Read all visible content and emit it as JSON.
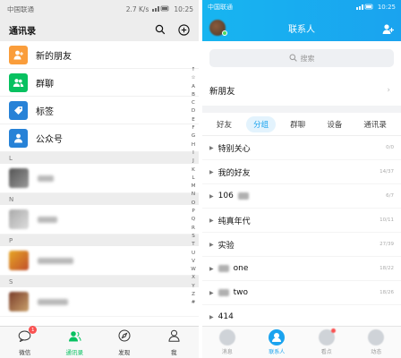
{
  "left": {
    "status": {
      "carrier": "中国联通",
      "speed": "2.7 K/s",
      "time": "10:25"
    },
    "title": "通讯录",
    "fixed_items": [
      {
        "label": "新的朋友",
        "icon": "person-add-icon",
        "color": "#fa9d3b"
      },
      {
        "label": "群聊",
        "icon": "group-icon",
        "color": "#07c160"
      },
      {
        "label": "标签",
        "icon": "tag-icon",
        "color": "#2782d7"
      },
      {
        "label": "公众号",
        "icon": "official-account-icon",
        "color": "#2782d7"
      }
    ],
    "sections": [
      "L",
      "N",
      "P",
      "S"
    ],
    "index": [
      "↑",
      "☆",
      "A",
      "B",
      "C",
      "D",
      "E",
      "F",
      "G",
      "H",
      "I",
      "J",
      "K",
      "L",
      "M",
      "N",
      "O",
      "P",
      "Q",
      "R",
      "S",
      "T",
      "U",
      "V",
      "W",
      "X",
      "Y",
      "Z",
      "#"
    ],
    "tabs": [
      {
        "label": "微信",
        "icon": "chat-icon",
        "badge": "1"
      },
      {
        "label": "通讯录",
        "icon": "contacts-icon",
        "badge": ""
      },
      {
        "label": "发现",
        "icon": "compass-icon",
        "badge": ""
      },
      {
        "label": "我",
        "icon": "me-icon",
        "badge": ""
      }
    ],
    "accent": "#07c160"
  },
  "right": {
    "status": {
      "carrier": "中国联通",
      "time": "10:25"
    },
    "title": "联系人",
    "search_placeholder": "搜索",
    "new_friend": "新朋友",
    "tabs": [
      "好友",
      "分组",
      "群聊",
      "设备",
      "通讯录"
    ],
    "active_tab": "分组",
    "groups": [
      {
        "name": "特别关心",
        "count": "0/0"
      },
      {
        "name": "我的好友",
        "count": "14/37"
      },
      {
        "name": "106",
        "count": "6/7"
      },
      {
        "name": "纯真年代",
        "count": "10/11"
      },
      {
        "name": "实验",
        "count": "27/39"
      },
      {
        "name": "one",
        "count": "18/22"
      },
      {
        "name": "two",
        "count": "18/26"
      },
      {
        "name": "414",
        "count": ""
      }
    ],
    "bottom_tabs": [
      {
        "label": "消息",
        "icon": "message-icon"
      },
      {
        "label": "联系人",
        "icon": "contact-icon"
      },
      {
        "label": "看点",
        "icon": "eye-icon"
      },
      {
        "label": "动态",
        "icon": "star-icon"
      }
    ],
    "accent": "#1aa3ef"
  }
}
